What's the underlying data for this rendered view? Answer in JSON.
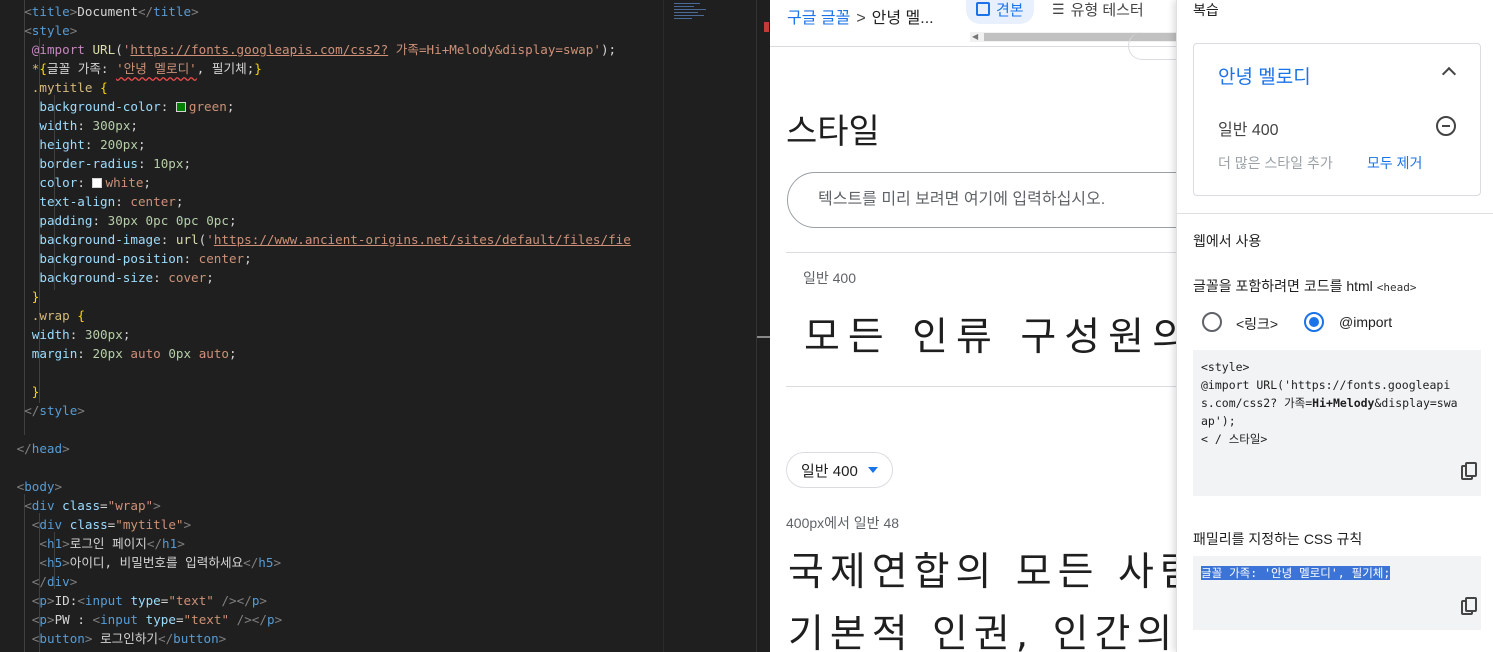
{
  "editor": {
    "lines": [
      [
        [
          "t-brk",
          "<"
        ],
        [
          "t-tag",
          "title"
        ],
        [
          "t-brk",
          ">"
        ],
        [
          "t-text",
          "Document"
        ],
        [
          "t-brk",
          "</"
        ],
        [
          "t-tag",
          "title"
        ],
        [
          "t-brk",
          ">"
        ]
      ],
      [
        [
          "t-brk",
          "<"
        ],
        [
          "t-tag",
          "style"
        ],
        [
          "t-brk",
          ">"
        ]
      ],
      [
        [
          "t-at",
          "@import"
        ],
        [
          "t-punc",
          " "
        ],
        [
          "t-fn",
          "URL"
        ],
        [
          "t-punc",
          "("
        ],
        [
          "t-str",
          "'"
        ],
        [
          "t-url",
          "https://fonts.googleapis.com/css2?"
        ],
        [
          "t-str",
          " 가족=Hi+Melody&display=swap'"
        ],
        [
          "t-punc",
          ");"
        ]
      ],
      [
        [
          "t-sel",
          "*"
        ],
        [
          "t-brace",
          "{"
        ],
        [
          "t-text",
          "글꼴 가족: "
        ],
        [
          "t-str t-squig",
          "'안녕 멜로디'"
        ],
        [
          "t-text",
          ", 필기체;"
        ],
        [
          "t-brace",
          "}"
        ]
      ],
      [
        [
          "t-sel",
          ".mytitle"
        ],
        [
          "t-punc",
          " "
        ],
        [
          "t-brace",
          "{"
        ]
      ],
      [
        [
          "t-prop",
          "background-color"
        ],
        [
          "t-punc",
          ": "
        ],
        [
          "swatch",
          "#008000"
        ],
        [
          "t-val",
          "green"
        ],
        [
          "t-punc",
          ";"
        ]
      ],
      [
        [
          "t-prop",
          "width"
        ],
        [
          "t-punc",
          ": "
        ],
        [
          "t-num",
          "300px"
        ],
        [
          "t-punc",
          ";"
        ]
      ],
      [
        [
          "t-prop",
          "height"
        ],
        [
          "t-punc",
          ": "
        ],
        [
          "t-num",
          "200px"
        ],
        [
          "t-punc",
          ";"
        ]
      ],
      [
        [
          "t-prop",
          "border-radius"
        ],
        [
          "t-punc",
          ": "
        ],
        [
          "t-num",
          "10px"
        ],
        [
          "t-punc",
          ";"
        ]
      ],
      [
        [
          "t-prop",
          "color"
        ],
        [
          "t-punc",
          ": "
        ],
        [
          "swatch",
          "#ffffff"
        ],
        [
          "t-val",
          "white"
        ],
        [
          "t-punc",
          ";"
        ]
      ],
      [
        [
          "t-prop",
          "text-align"
        ],
        [
          "t-punc",
          ": "
        ],
        [
          "t-val",
          "center"
        ],
        [
          "t-punc",
          ";"
        ]
      ],
      [
        [
          "t-prop",
          "padding"
        ],
        [
          "t-punc",
          ": "
        ],
        [
          "t-num",
          "30px 0pc 0pc 0pc"
        ],
        [
          "t-punc",
          ";"
        ]
      ],
      [
        [
          "t-prop",
          "background-image"
        ],
        [
          "t-punc",
          ": "
        ],
        [
          "t-fn",
          "url"
        ],
        [
          "t-punc",
          "("
        ],
        [
          "t-str",
          "'"
        ],
        [
          "t-url",
          "https://www.ancient-origins.net/sites/default/files/fie"
        ]
      ],
      [
        [
          "t-prop",
          "background-position"
        ],
        [
          "t-punc",
          ": "
        ],
        [
          "t-val",
          "center"
        ],
        [
          "t-punc",
          ";"
        ]
      ],
      [
        [
          "t-prop",
          "background-size"
        ],
        [
          "t-punc",
          ": "
        ],
        [
          "t-val",
          "cover"
        ],
        [
          "t-punc",
          ";"
        ]
      ],
      [
        [
          "t-brace",
          "}"
        ]
      ],
      [
        [
          "t-sel",
          ".wrap"
        ],
        [
          "t-punc",
          " "
        ],
        [
          "t-brace",
          "{"
        ]
      ],
      [
        [
          "t-prop",
          "width"
        ],
        [
          "t-punc",
          ": "
        ],
        [
          "t-num",
          "300px"
        ],
        [
          "t-punc",
          ";"
        ]
      ],
      [
        [
          "t-prop",
          "margin"
        ],
        [
          "t-punc",
          ": "
        ],
        [
          "t-num",
          "20px"
        ],
        [
          "t-punc",
          " "
        ],
        [
          "t-val",
          "auto"
        ],
        [
          "t-punc",
          " "
        ],
        [
          "t-num",
          "0px"
        ],
        [
          "t-punc",
          " "
        ],
        [
          "t-val",
          "auto"
        ],
        [
          "t-punc",
          ";"
        ]
      ],
      [],
      [
        [
          "t-brace",
          "}"
        ]
      ],
      [
        [
          "t-brk",
          "</"
        ],
        [
          "t-tag",
          "style"
        ],
        [
          "t-brk",
          ">"
        ]
      ],
      [],
      [
        [
          "t-brk",
          "</"
        ],
        [
          "t-tag",
          "head"
        ],
        [
          "t-brk",
          ">"
        ]
      ],
      [],
      [
        [
          "t-brk",
          "<"
        ],
        [
          "t-tag",
          "body"
        ],
        [
          "t-brk",
          ">"
        ]
      ],
      [
        [
          "t-brk",
          "<"
        ],
        [
          "t-tag",
          "div"
        ],
        [
          "t-punc",
          " "
        ],
        [
          "t-attr",
          "class"
        ],
        [
          "t-punc",
          "="
        ],
        [
          "t-str",
          "\"wrap\""
        ],
        [
          "t-brk",
          ">"
        ]
      ],
      [
        [
          "t-brk",
          "<"
        ],
        [
          "t-tag",
          "div"
        ],
        [
          "t-punc",
          " "
        ],
        [
          "t-attr",
          "class"
        ],
        [
          "t-punc",
          "="
        ],
        [
          "t-str",
          "\"mytitle\""
        ],
        [
          "t-brk",
          ">"
        ]
      ],
      [
        [
          "t-brk",
          "<"
        ],
        [
          "t-tag",
          "h1"
        ],
        [
          "t-brk",
          ">"
        ],
        [
          "t-text",
          "로그인 페이지"
        ],
        [
          "t-brk",
          "</"
        ],
        [
          "t-tag",
          "h1"
        ],
        [
          "t-brk",
          ">"
        ]
      ],
      [
        [
          "t-brk",
          "<"
        ],
        [
          "t-tag",
          "h5"
        ],
        [
          "t-brk",
          ">"
        ],
        [
          "t-text",
          "아이디, 비밀번호를 입력하세요"
        ],
        [
          "t-brk",
          "</"
        ],
        [
          "t-tag",
          "h5"
        ],
        [
          "t-brk",
          ">"
        ]
      ],
      [
        [
          "t-brk",
          "</"
        ],
        [
          "t-tag",
          "div"
        ],
        [
          "t-brk",
          ">"
        ]
      ],
      [
        [
          "t-brk",
          "<"
        ],
        [
          "t-tag",
          "p"
        ],
        [
          "t-brk",
          ">"
        ],
        [
          "t-text",
          "ID:"
        ],
        [
          "t-brk",
          "<"
        ],
        [
          "t-tag",
          "input"
        ],
        [
          "t-punc",
          " "
        ],
        [
          "t-attr",
          "type"
        ],
        [
          "t-punc",
          "="
        ],
        [
          "t-str",
          "\"text\""
        ],
        [
          "t-punc",
          " "
        ],
        [
          "t-brk",
          "/></"
        ],
        [
          "t-tag",
          "p"
        ],
        [
          "t-brk",
          ">"
        ]
      ],
      [
        [
          "t-brk",
          "<"
        ],
        [
          "t-tag",
          "p"
        ],
        [
          "t-brk",
          ">"
        ],
        [
          "t-text",
          "PW : "
        ],
        [
          "t-brk",
          "<"
        ],
        [
          "t-tag",
          "input"
        ],
        [
          "t-punc",
          " "
        ],
        [
          "t-attr",
          "type"
        ],
        [
          "t-punc",
          "="
        ],
        [
          "t-str",
          "\"text\""
        ],
        [
          "t-punc",
          " "
        ],
        [
          "t-brk",
          "/></"
        ],
        [
          "t-tag",
          "p"
        ],
        [
          "t-brk",
          ">"
        ]
      ],
      [
        [
          "t-brk",
          "<"
        ],
        [
          "t-tag",
          "button"
        ],
        [
          "t-brk",
          ">"
        ],
        [
          "t-text",
          " 로그인하기"
        ],
        [
          "t-brk",
          "</"
        ],
        [
          "t-tag",
          "button"
        ],
        [
          "t-brk",
          ">"
        ]
      ]
    ]
  },
  "browser": {
    "breadcrumb": {
      "root": "구글 글꼴",
      "sep": ">",
      "current": "안녕 멜..."
    },
    "tabs": {
      "specimen": "견본",
      "type_tester": "유형 테스터"
    },
    "styles_heading": "스타일",
    "preview_placeholder": "텍스트를 미리 보려면 여기에 입력하십시오.",
    "style_label": "일반 400",
    "sample_1": "모든 인류 구성원의 천",
    "weight_select": "일반 400",
    "size_label": "400px에서 일반 48",
    "sample_2_line_1": "국제연합의 모든 사람들",
    "sample_2_line_2": "기본적 인권, 인간의 존"
  },
  "panel": {
    "title": "복습",
    "family_name": "안녕 멜로디",
    "selected_style": "일반 400",
    "add_more": "더 많은 스타일 추가",
    "remove_all": "모두 제거",
    "web_use": "웹에서 사용",
    "embed_desc": "글꼴을 포함하려면 코드를 html",
    "head_tag": "<head>",
    "radio_link": "<링크>",
    "radio_import": "@import",
    "embed_code": {
      "l1": "<style>",
      "l2": "@import URL('https://fonts.googleapi",
      "l3a": "s.com/css2? 가족=",
      "l3b": "Hi+Melody",
      "l3c": "&display=swa",
      "l4": "ap');",
      "l5": "< / 스타일>"
    },
    "css_rules_title": "패밀리를 지정하는 CSS 규칙",
    "css_rule": "글꼴 가족: '안녕 멜로디', 필기체;"
  }
}
